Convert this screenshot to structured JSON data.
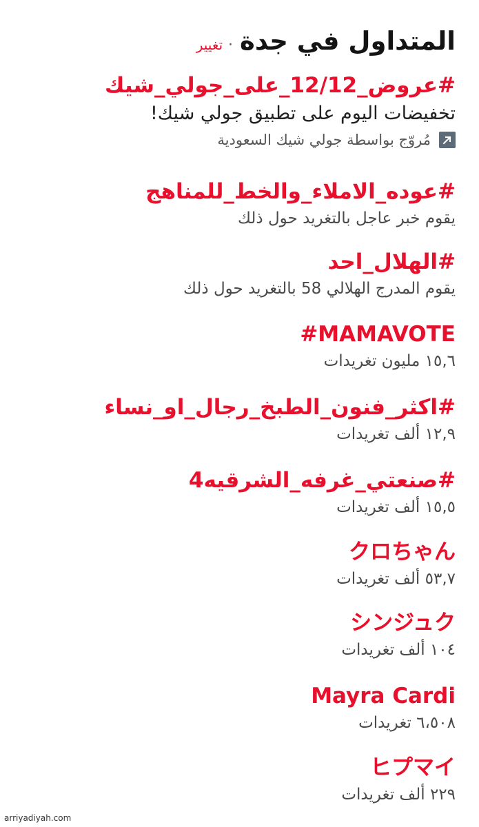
{
  "header": {
    "title": "المتداول في جدة",
    "separator": "·",
    "change_link": "تغيير"
  },
  "trends": [
    {
      "name": "#عروض_12/12_على_جولي_شيك",
      "description": "تخفيضات اليوم على تطبيق جولي شيك!",
      "promoted_by": "مُروّج بواسطة جولي شيك السعودية",
      "promoted_icon": "promoted-arrow-icon"
    },
    {
      "name": "#عوده_الاملاء_والخط_للمناهج",
      "description": "يقوم خبر عاجل بالتغريد حول ذلك"
    },
    {
      "name": "#الهلال_احد",
      "description": "يقوم المدرج الهلالي 58 بالتغريد حول ذلك"
    },
    {
      "name": "#MAMAVOTE",
      "description": "١٥,٦ مليون تغريدات"
    },
    {
      "name": "#اكثر_فنون_الطبخ_رجال_او_نساء",
      "description": "١٢,٩ ألف تغريدات"
    },
    {
      "name": "#صنعتي_غرفه_الشرقيه4",
      "description": "١٥,٥ ألف تغريدات"
    },
    {
      "name": "クロちゃん",
      "description": "٥٣,٧ ألف تغريدات"
    },
    {
      "name": "シンジュク",
      "description": "١٠٤ ألف تغريدات"
    },
    {
      "name": "Mayra Cardi",
      "description": "٦،٥٠٨ تغريدات"
    },
    {
      "name": "ヒプマイ",
      "description": "٢٢٩ ألف تغريدات"
    }
  ],
  "footer": {
    "watermark": "arriyadiyah.com"
  },
  "colors": {
    "accent": "#e8112d",
    "title": "#141414",
    "muted": "#4a4a4a"
  }
}
